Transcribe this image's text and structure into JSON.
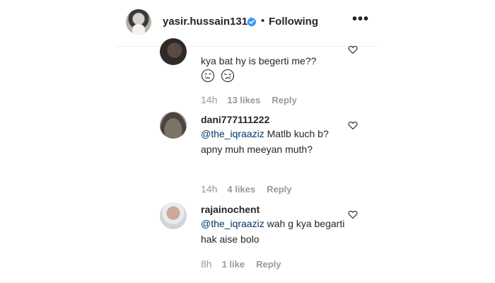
{
  "post_header": {
    "username": "yasir.hussain131",
    "separator": "•",
    "follow_status": "Following",
    "more_label": "•••"
  },
  "comments": [
    {
      "username": "",
      "text": "kya bat hy is begerti me??",
      "emoji": [
        "crying-face",
        "crying-face"
      ],
      "time": "14h",
      "likes": "13 likes",
      "reply": "Reply"
    },
    {
      "username": "dani777111222",
      "mention": "@the_iqraaziz",
      "text": " Matlb kuch b? apny muh meeyan muth?",
      "time": "14h",
      "likes": "4 likes",
      "reply": "Reply"
    },
    {
      "username": "rajainochent",
      "mention": "@the_iqraaziz",
      "text": " wah g kya begarti hak aise bolo",
      "time": "8h",
      "likes": "1 like",
      "reply": "Reply"
    }
  ],
  "colors": {
    "text": "#262626",
    "mention": "#003569",
    "meta": "#999999",
    "verified": "#3897f0"
  }
}
